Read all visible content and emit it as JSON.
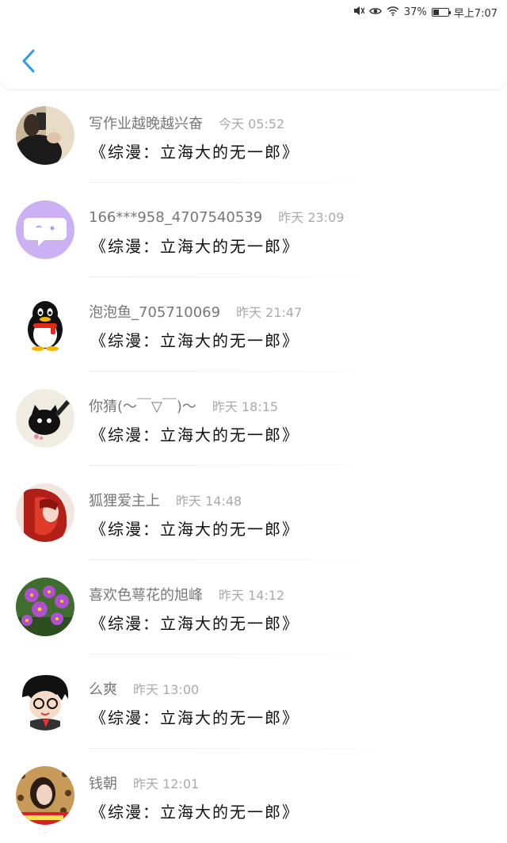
{
  "status_bar": {
    "mute_icon": "mute-icon",
    "eye_icon": "eye-comfort-icon",
    "wifi_icon": "wifi-icon",
    "battery_percent": "37%",
    "battery_level": 0.37,
    "time": "早上7:07"
  },
  "header": {
    "back_icon": "chevron-left-icon",
    "accent_color": "#2b9cf2"
  },
  "items": [
    {
      "username": "写作业越晚越兴奋",
      "time": "今天 05:52",
      "message": "《综漫：立海大的无一郎》",
      "avatar_icon": "photo-avatar-dark"
    },
    {
      "username": "166***958_4707540539",
      "time": "昨天 23:09",
      "message": "《综漫：立海大的无一郎》",
      "avatar_icon": "chat-bubble-avatar"
    },
    {
      "username": "泡泡鱼_705710069",
      "time": "昨天 21:47",
      "message": "《综漫：立海大的无一郎》",
      "avatar_icon": "penguin-avatar"
    },
    {
      "username": "你猜(〜￣▽￣)〜",
      "time": "昨天 18:15",
      "message": "《综漫：立海大的无一郎》",
      "avatar_icon": "black-cat-avatar"
    },
    {
      "username": "狐狸爱主上",
      "time": "昨天 14:48",
      "message": "《综漫：立海大的无一郎》",
      "avatar_icon": "red-hair-anime-avatar"
    },
    {
      "username": "喜欢色萼花的旭峰",
      "time": "昨天 14:12",
      "message": "《综漫：立海大的无一郎》",
      "avatar_icon": "purple-flower-avatar"
    },
    {
      "username": "么爽",
      "time": "昨天 13:00",
      "message": "《综漫：立海大的无一郎》",
      "avatar_icon": "cartoon-boy-avatar"
    },
    {
      "username": "钱朝",
      "time": "昨天 12:01",
      "message": "《综漫：立海大的无一郎》",
      "avatar_icon": "photo-avatar-leopard"
    }
  ]
}
